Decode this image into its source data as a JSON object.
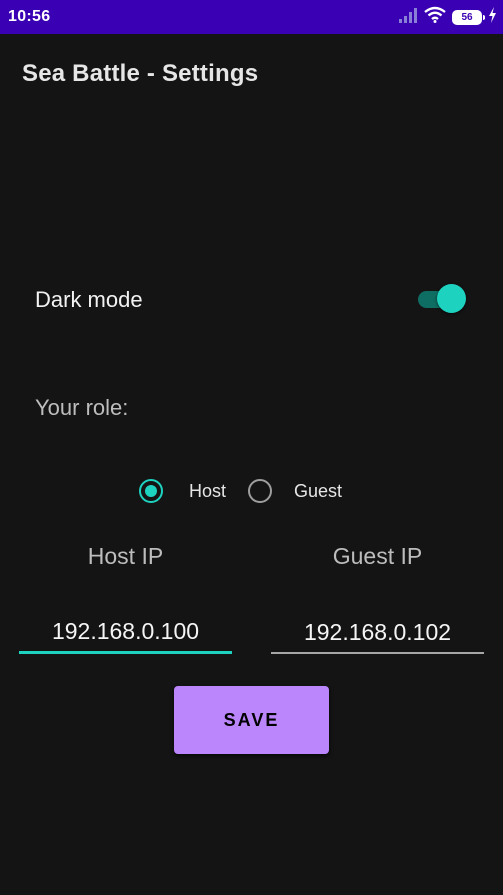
{
  "status_bar": {
    "time": "10:56",
    "battery_level": "56",
    "icons": [
      "signal-icon",
      "wifi-icon",
      "battery-icon",
      "charging-icon"
    ],
    "background": "#3a00b4"
  },
  "app_bar": {
    "title": "Sea Battle - Settings"
  },
  "settings": {
    "dark_mode_label": "Dark mode",
    "dark_mode_on": true,
    "role_label": "Your role:",
    "roles": [
      {
        "label": "Host",
        "checked": true
      },
      {
        "label": "Guest",
        "checked": false
      }
    ],
    "host_ip_label": "Host IP",
    "guest_ip_label": "Guest IP",
    "host_ip_value": "192.168.0.100",
    "guest_ip_value": "192.168.0.102",
    "save_label": "SAVE"
  },
  "colors": {
    "accent": "#1ed2c0",
    "primary": "#bb86fc",
    "background": "#141414"
  }
}
